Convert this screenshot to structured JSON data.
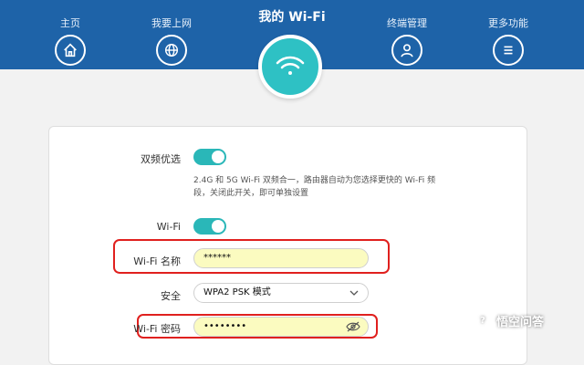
{
  "header": {
    "title": "我的 Wi-Fi",
    "nav": [
      {
        "label": "主页",
        "icon": "home-icon"
      },
      {
        "label": "我要上网",
        "icon": "globe-icon"
      },
      {
        "label": "终端管理",
        "icon": "user-icon"
      },
      {
        "label": "更多功能",
        "icon": "menu-icon"
      }
    ],
    "center_icon": "wifi-icon",
    "bar_color": "#1e63a8",
    "accent_color": "#2ec1c4"
  },
  "settings": {
    "dual_band": {
      "label": "双频优选",
      "enabled": true,
      "description": "2.4G 和 5G Wi-Fi 双频合一，路由器自动为您选择更快的 Wi-Fi 频段，关闭此开关，即可单独设置"
    },
    "wifi": {
      "label": "Wi-Fi",
      "enabled": true
    },
    "wifi_name": {
      "label": "Wi-Fi 名称",
      "value": "******"
    },
    "security": {
      "label": "安全",
      "value": "WPA2 PSK 模式"
    },
    "wifi_password": {
      "label": "Wi-Fi 密码",
      "value": "••••••••"
    }
  },
  "watermark": {
    "text": "悟空问答"
  }
}
